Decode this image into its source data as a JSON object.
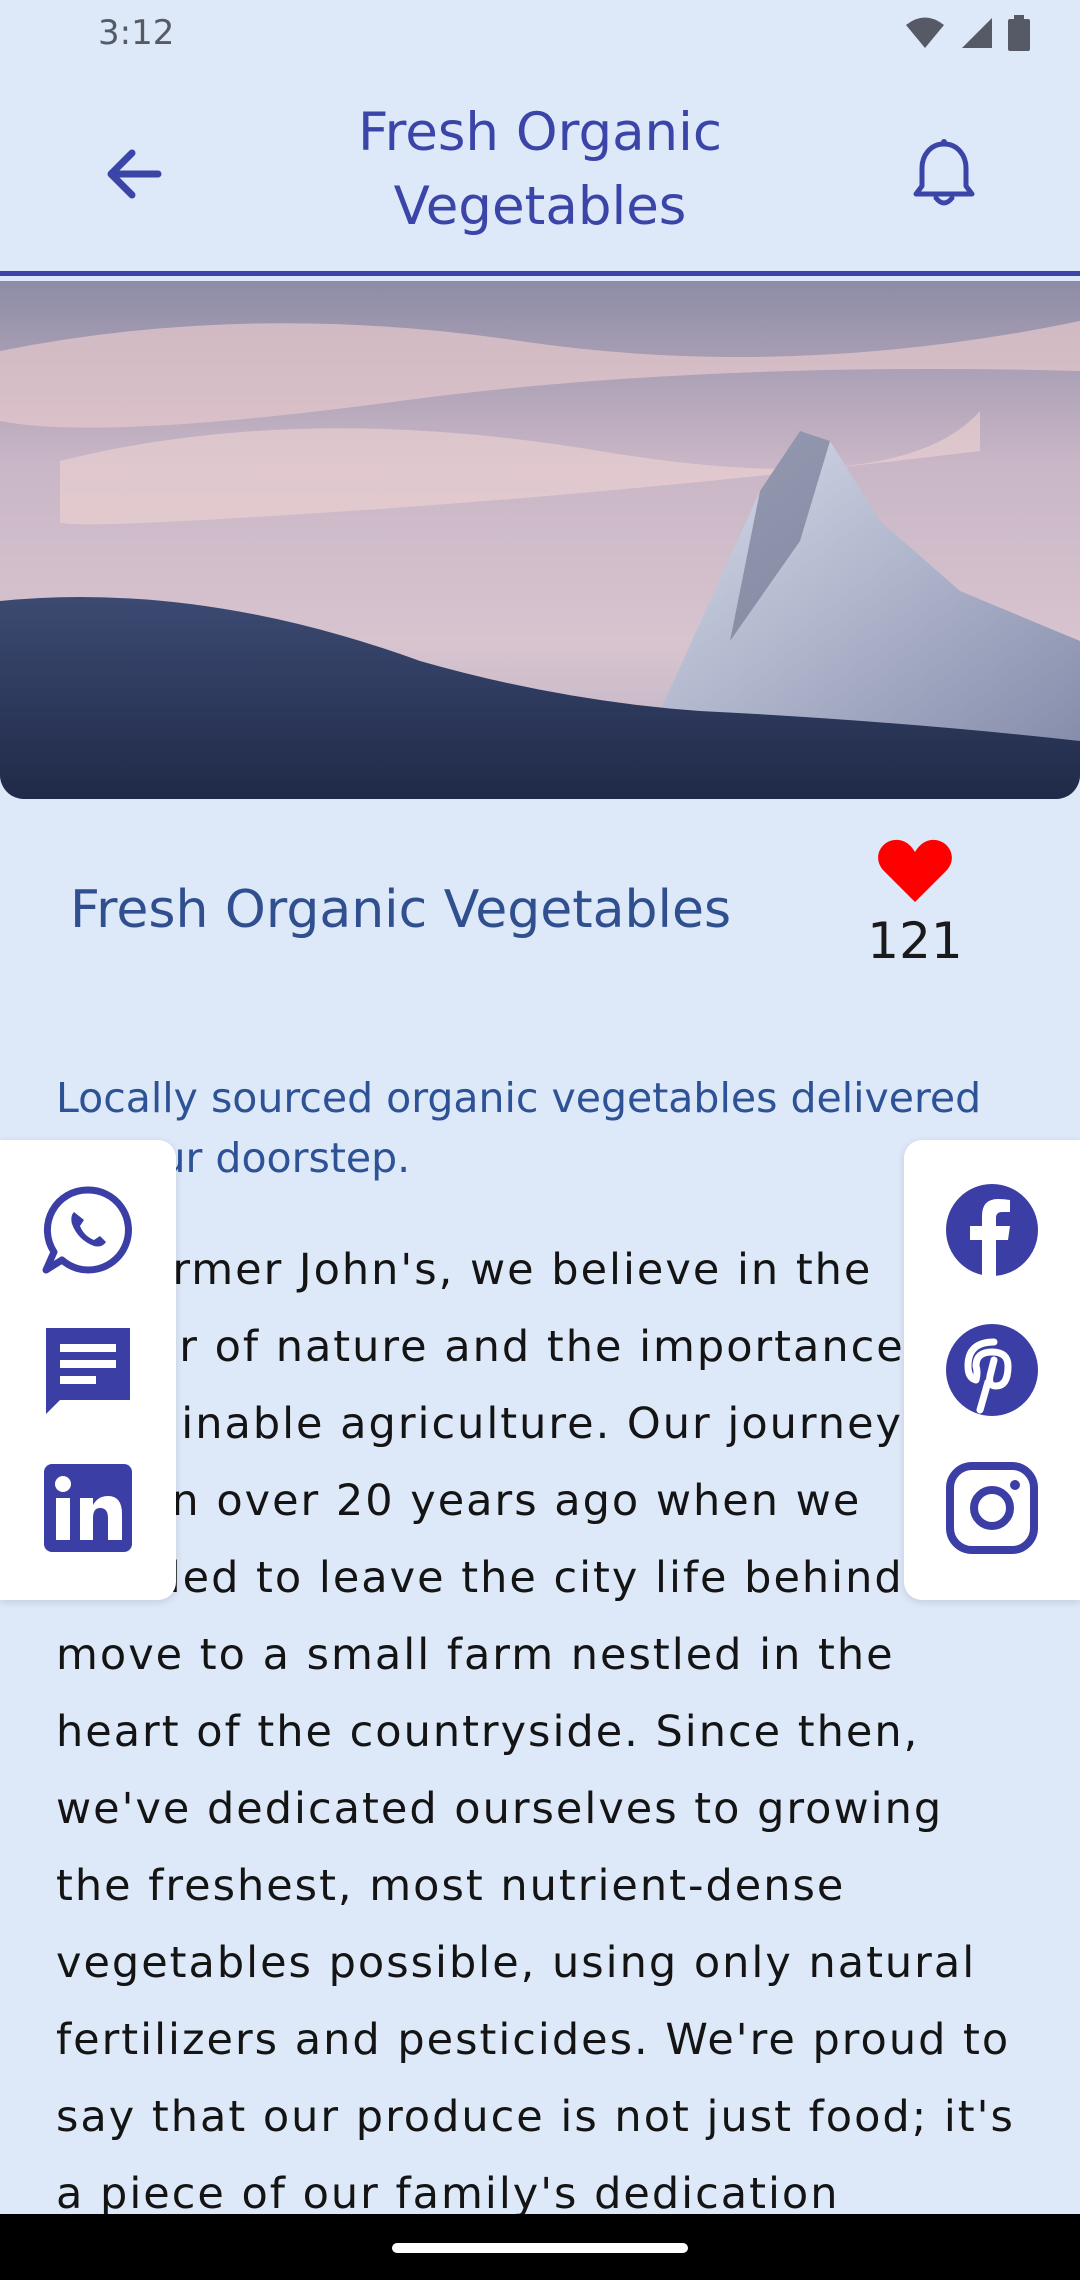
{
  "status_bar": {
    "time": "3:12"
  },
  "app_bar": {
    "title": "Fresh Organic Vegetables"
  },
  "post": {
    "headline": "Fresh Organic Vegetables",
    "likes": "121",
    "subtitle": "Locally sourced organic vegetables delivered to your doorstep.",
    "body": "At Farmer John's, we believe in the power of nature and the importance of sustainable agriculture. Our journey began over 20 years ago when we decided to leave the city life behind and move to a small farm nestled in the heart of the countryside. Since then, we've dedicated ourselves to growing the freshest, most nutrient-dense vegetables possible, using only natural fertilizers and pesticides. We're proud to say that our produce is not just food; it's a piece of our family's dedication"
  },
  "share_left": [
    "whatsapp-icon",
    "sms-icon",
    "linkedin-icon"
  ],
  "share_right": [
    "facebook-icon",
    "pinterest-icon",
    "instagram-icon"
  ],
  "colors": {
    "accent": "#3f45a8",
    "background": "#dde8f8",
    "heart": "#ff0000"
  }
}
